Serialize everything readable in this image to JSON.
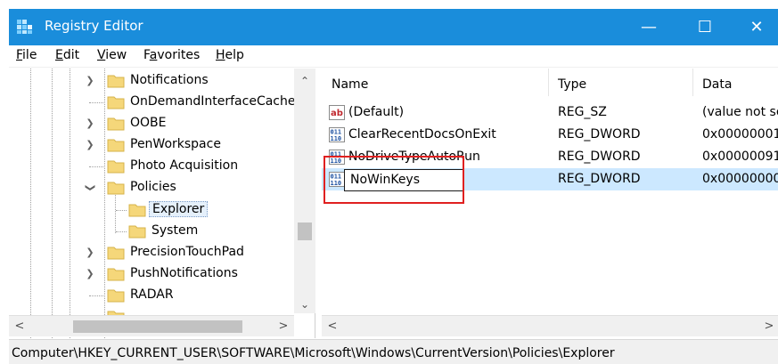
{
  "window": {
    "title": "Registry Editor",
    "controls": {
      "minimize": "—",
      "maximize": "☐",
      "close": "✕"
    },
    "titlebar_color": "#1a8ddb"
  },
  "menu": {
    "items": [
      {
        "label": "File",
        "mnemonic": "F",
        "rest": "ile"
      },
      {
        "label": "Edit",
        "mnemonic": "E",
        "rest": "dit"
      },
      {
        "label": "View",
        "mnemonic": "V",
        "rest": "iew"
      },
      {
        "label": "Favorites",
        "mnemonic": "a",
        "prefix": "F",
        "rest": "vorites"
      },
      {
        "label": "Help",
        "mnemonic": "H",
        "rest": "elp"
      }
    ]
  },
  "tree": {
    "items": [
      {
        "label": "Notifications",
        "expander": "collapsed"
      },
      {
        "label": "OnDemandInterfaceCache",
        "expander": "none"
      },
      {
        "label": "OOBE",
        "expander": "collapsed"
      },
      {
        "label": "PenWorkspace",
        "expander": "collapsed"
      },
      {
        "label": "Photo Acquisition",
        "expander": "none"
      },
      {
        "label": "Policies",
        "expander": "expanded"
      },
      {
        "label": "Explorer",
        "expander": "none",
        "child": true,
        "selected": true
      },
      {
        "label": "System",
        "expander": "none",
        "child": true
      },
      {
        "label": "PrecisionTouchPad",
        "expander": "collapsed"
      },
      {
        "label": "PushNotifications",
        "expander": "collapsed"
      },
      {
        "label": "RADAR",
        "expander": "none"
      }
    ]
  },
  "values": {
    "columns": [
      "Name",
      "Type",
      "Data"
    ],
    "rows": [
      {
        "icon": "string-value-icon",
        "name": "(Default)",
        "type": "REG_SZ",
        "data": "(value not se"
      },
      {
        "icon": "dword-value-icon",
        "name": "ClearRecentDocsOnExit",
        "type": "REG_DWORD",
        "data": "0x00000001 ("
      },
      {
        "icon": "dword-value-icon",
        "name": "NoDriveTypeAutoRun",
        "type": "REG_DWORD",
        "data": "0x00000091 ("
      },
      {
        "icon": "dword-value-icon",
        "name": "",
        "type": "REG_DWORD",
        "data": "0x00000000 (",
        "selected": true
      }
    ],
    "rename_value": "NoWinKeys"
  },
  "status": {
    "path": "Computer\\HKEY_CURRENT_USER\\SOFTWARE\\Microsoft\\Windows\\CurrentVersion\\Policies\\Explorer"
  },
  "scroll": {
    "up": "⌃",
    "down": "⌄",
    "left": "<",
    "right": ">"
  }
}
